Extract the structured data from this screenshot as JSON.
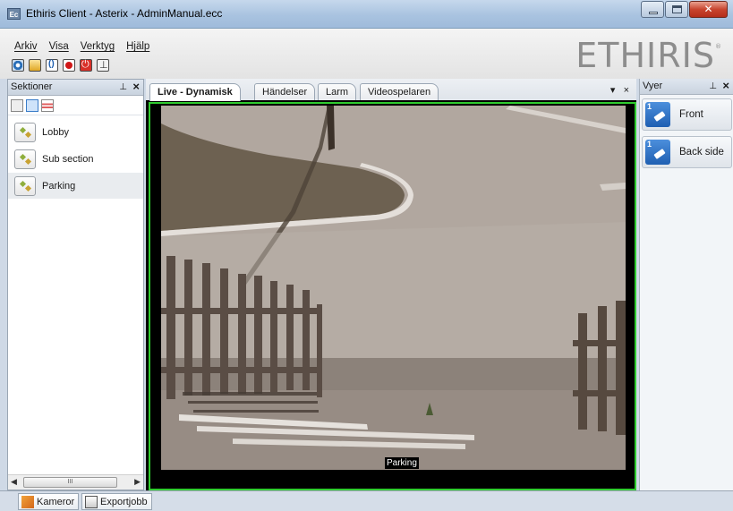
{
  "window": {
    "title": "Ethiris Client - Asterix - AdminManual.ecc",
    "app_icon_text": "Ec"
  },
  "menu": [
    "Arkiv",
    "Visa",
    "Verktyg",
    "Hjälp"
  ],
  "toolbar": [
    {
      "icon": "settings-icon"
    },
    {
      "icon": "folder-icon"
    },
    {
      "icon": "refresh-icon"
    },
    {
      "icon": "record-icon"
    },
    {
      "icon": "power-icon"
    },
    {
      "icon": "export-icon"
    }
  ],
  "logo": {
    "text": "ETHIRIS",
    "mark": "®"
  },
  "sections_panel": {
    "title": "Sektioner",
    "items": [
      {
        "label": "Lobby",
        "selected": false
      },
      {
        "label": "Sub section",
        "selected": false
      },
      {
        "label": "Parking",
        "selected": true
      }
    ],
    "scroll_thumb": "III"
  },
  "tabs": [
    {
      "label": "Live - Dynamisk",
      "active": true
    },
    {
      "label": "Händelser",
      "active": false
    },
    {
      "label": "Larm",
      "active": false
    },
    {
      "label": "Videospelaren",
      "active": false
    }
  ],
  "tab_controls": {
    "dropdown": "▾",
    "close": "×"
  },
  "camera": {
    "label": "Parking",
    "border_color": "#2fcc2f"
  },
  "views_panel": {
    "title": "Vyer",
    "items": [
      {
        "label": "Front",
        "badge": "1"
      },
      {
        "label": "Back side",
        "badge": "1"
      }
    ]
  },
  "bottom_tabs": [
    {
      "label": "Kameror",
      "icon": "camera-icon"
    },
    {
      "label": "Exportjobb",
      "icon": "export-jobs-icon"
    }
  ]
}
